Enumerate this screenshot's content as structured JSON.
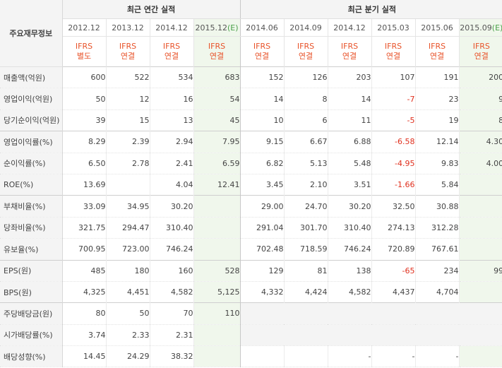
{
  "header": {
    "corner_label": "주요재무정보",
    "annual_title": "최근 연간 실적",
    "quarter_title": "최근 분기 실적",
    "periods": [
      {
        "label": "2012.12",
        "mark": "",
        "estimate": false
      },
      {
        "label": "2013.12",
        "mark": "",
        "estimate": false
      },
      {
        "label": "2014.12",
        "mark": "",
        "estimate": false
      },
      {
        "label": "2015.12",
        "mark": "(E)",
        "estimate": true
      },
      {
        "label": "2014.06",
        "mark": "",
        "estimate": false
      },
      {
        "label": "2014.09",
        "mark": "",
        "estimate": false
      },
      {
        "label": "2014.12",
        "mark": "",
        "estimate": false
      },
      {
        "label": "2015.03",
        "mark": "",
        "estimate": false
      },
      {
        "label": "2015.06",
        "mark": "",
        "estimate": false
      },
      {
        "label": "2015.09",
        "mark": "(E)",
        "estimate": true
      }
    ],
    "ifrs": [
      {
        "l1": "IFRS",
        "l2": "별도"
      },
      {
        "l1": "IFRS",
        "l2": "연결"
      },
      {
        "l1": "IFRS",
        "l2": "연결"
      },
      {
        "l1": "IFRS",
        "l2": "연결"
      },
      {
        "l1": "IFRS",
        "l2": "연결"
      },
      {
        "l1": "IFRS",
        "l2": "연결"
      },
      {
        "l1": "IFRS",
        "l2": "연결"
      },
      {
        "l1": "IFRS",
        "l2": "연결"
      },
      {
        "l1": "IFRS",
        "l2": "연결"
      },
      {
        "l1": "IFRS",
        "l2": "연결"
      }
    ]
  },
  "rows": [
    {
      "label": "매출액(억원)",
      "group_start": true,
      "values": [
        "600",
        "522",
        "534",
        "683",
        "152",
        "126",
        "203",
        "107",
        "191",
        "200"
      ]
    },
    {
      "label": "영업이익(억원)",
      "group_start": false,
      "values": [
        "50",
        "12",
        "16",
        "54",
        "14",
        "8",
        "14",
        "-7",
        "23",
        "9"
      ]
    },
    {
      "label": "당기순이익(억원)",
      "group_start": false,
      "values": [
        "39",
        "15",
        "13",
        "45",
        "10",
        "6",
        "11",
        "-5",
        "19",
        "8"
      ]
    },
    {
      "label": "영업이익률(%)",
      "group_start": true,
      "values": [
        "8.29",
        "2.39",
        "2.94",
        "7.95",
        "9.15",
        "6.67",
        "6.88",
        "-6.58",
        "12.14",
        "4.30"
      ]
    },
    {
      "label": "순이익률(%)",
      "group_start": false,
      "values": [
        "6.50",
        "2.78",
        "2.41",
        "6.59",
        "6.82",
        "5.13",
        "5.48",
        "-4.95",
        "9.83",
        "4.00"
      ]
    },
    {
      "label": "ROE(%)",
      "group_start": false,
      "values": [
        "13.69",
        "",
        "4.04",
        "12.41",
        "3.45",
        "2.10",
        "3.51",
        "-1.66",
        "5.84",
        ""
      ]
    },
    {
      "label": "부채비율(%)",
      "group_start": true,
      "values": [
        "33.09",
        "34.95",
        "30.20",
        "",
        "29.00",
        "24.70",
        "30.20",
        "32.50",
        "30.88",
        ""
      ]
    },
    {
      "label": "당좌비율(%)",
      "group_start": false,
      "values": [
        "321.75",
        "294.47",
        "310.40",
        "",
        "291.04",
        "301.70",
        "310.40",
        "274.13",
        "312.28",
        ""
      ]
    },
    {
      "label": "유보율(%)",
      "group_start": false,
      "values": [
        "700.95",
        "723.00",
        "746.24",
        "",
        "702.48",
        "718.59",
        "746.24",
        "720.89",
        "767.61",
        ""
      ]
    },
    {
      "label": "EPS(원)",
      "group_start": true,
      "values": [
        "485",
        "180",
        "160",
        "528",
        "129",
        "81",
        "138",
        "-65",
        "234",
        "99"
      ]
    },
    {
      "label": "BPS(원)",
      "group_start": false,
      "values": [
        "4,325",
        "4,451",
        "4,582",
        "5,125",
        "4,332",
        "4,424",
        "4,582",
        "4,437",
        "4,704",
        ""
      ]
    },
    {
      "label": "주당배당금(원)",
      "group_start": true,
      "values": [
        "80",
        "50",
        "70",
        "110",
        null,
        null,
        null,
        null,
        null,
        null
      ]
    },
    {
      "label": "시가배당률(%)",
      "group_start": false,
      "values": [
        "3.74",
        "2.33",
        "2.31",
        "",
        null,
        null,
        null,
        null,
        null,
        null
      ]
    },
    {
      "label": "배당성향(%)",
      "group_start": false,
      "values": [
        "14.45",
        "24.29",
        "38.32",
        "",
        "",
        "",
        "-",
        "-",
        "-",
        ""
      ]
    }
  ],
  "colors": {
    "negative": "#e0301e",
    "ifrs_label": "#e8532a",
    "estimate_col_bg": "#f0f7ec",
    "estimate_mark": "#48a048",
    "label_col_bg": "#f4f4f4"
  }
}
